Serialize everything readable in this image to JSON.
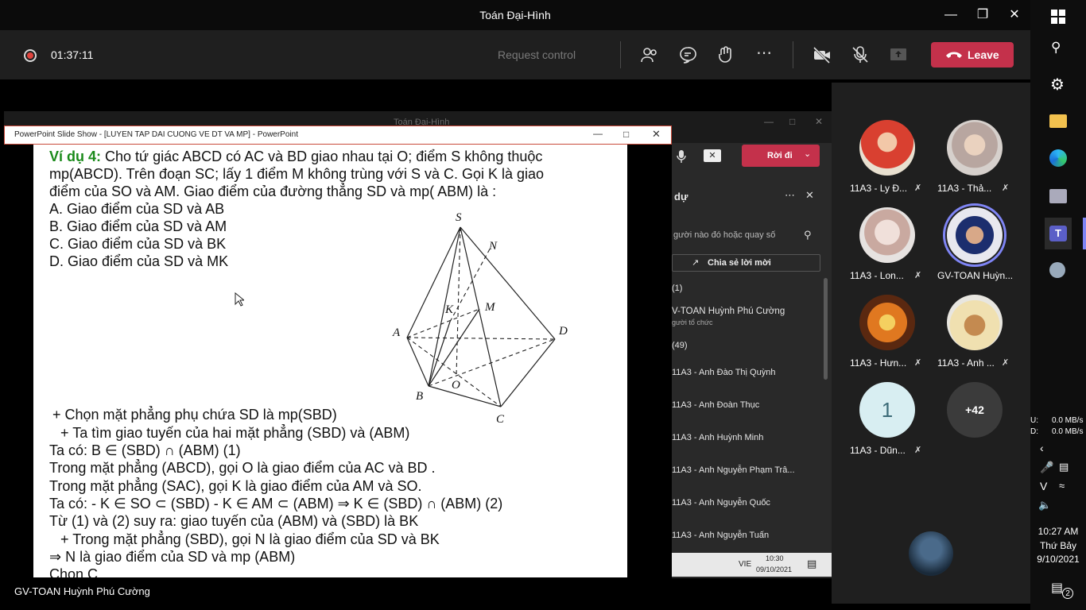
{
  "window": {
    "title": "Toán Đại-Hình"
  },
  "toolbar": {
    "timer": "01:37:11",
    "request_control": "Request control",
    "leave": "Leave"
  },
  "inner_window": {
    "title": "Toán Đại-Hình"
  },
  "ppt": {
    "title": "PowerPoint Slide Show - [LUYEN TAP DAI CUONG VE DT VA MP] - PowerPoint"
  },
  "slide": {
    "example_label": "Ví dụ 4:",
    "line1": " Cho tứ giác ABCD có AC và BD giao nhau tại O; điểm S không thuộc",
    "line2": "mp(ABCD). Trên đoạn SC; lấy 1 điểm M không trùng với S và C. Gọi K là giao",
    "line3": "điểm của SO và AM. Giao điểm của đường thẳng SD và mp( ABM) là :",
    "optA": "A. Giao điểm của SD và AB",
    "optB": "B. Giao điểm của SD và AM",
    "optC": "C. Giao điểm của SD và BK",
    "optD": "D. Giao điểm của SD và MK",
    "sol1": "+ Chọn mặt phẳng phụ chứa SD là mp(SBD)",
    "sol2": "+ Ta tìm giao tuyến của hai mặt phẳng (SBD) và (ABM)",
    "sol3": "Ta có: B ∈ (SBD) ∩ (ABM)    (1)",
    "sol4": "Trong mặt phẳng (ABCD), gọi O là giao điểm của AC và BD .",
    "sol5": "Trong mặt phẳng (SAC), gọi K là giao điểm của AM và SO.",
    "sol6": "Ta có: - K ∈ SO ⊂ (SBD)  - K ∈ AM ⊂ (ABM)  ⇒ K ∈ (SBD) ∩ (ABM)     (2)",
    "sol7": "Từ (1) và (2) suy ra: giao tuyến của (ABM) và (SBD) là BK",
    "sol8": "+ Trong mặt phẳng (SBD), gọi N là giao điểm của SD và BK",
    "sol9": "⇒ N là giao điểm của SD và mp (ABM)",
    "sol10": "Chọn C",
    "labels": {
      "S": "S",
      "N": "N",
      "K": "K",
      "M": "M",
      "A": "A",
      "D": "D",
      "O": "O",
      "B": "B",
      "C": "C"
    }
  },
  "panel": {
    "leave_btn": "Rời đi",
    "header": "dự",
    "search_placeholder": "gười nào đó hoặc quay số",
    "share_invite": "Chia sẻ lời mời",
    "section1": "(1)",
    "organizer_name": "V-TOAN Huỳnh Phú Cường",
    "organizer_role": "gười tổ chức",
    "section2": "(49)",
    "attendees": [
      "11A3 - Anh Đào Thị Quỳnh",
      "11A3 - Anh Đoàn Thục",
      "11A3 - Anh Huỳnh Minh",
      "11A3 - Anh Nguyễn Phạm Trâ...",
      "11A3 - Anh Nguyễn Quốc",
      "11A3 - Anh Nguyễn Tuấn"
    ],
    "taskbar_lang": "VIE",
    "taskbar_time": "10:30",
    "taskbar_date": "09/10/2021"
  },
  "gallery": {
    "tiles": [
      {
        "name": "11A3 - Ly Đ..."
      },
      {
        "name": "11A3 - Thả..."
      },
      {
        "name": "11A3 - Lon..."
      },
      {
        "name": "GV-TOAN Huỳn..."
      },
      {
        "name": "11A3 - Hưn..."
      },
      {
        "name": "11A3 - Anh ..."
      },
      {
        "name": "11A3 - Dũn...",
        "initial": "1"
      },
      {
        "name": "",
        "initial": "+42"
      }
    ]
  },
  "presenter_name": "GV-TOAN Huỳnh Phú Cường",
  "system": {
    "net_up": "0.0 MB/s",
    "net_down": "0.0 MB/s",
    "net_up_label": "U:",
    "net_down_label": "D:",
    "time": "10:27 AM",
    "day": "Thứ Bảy",
    "date": "9/10/2021",
    "notif_count": "2"
  },
  "colors": {
    "leave": "#c4314b",
    "teams_purple": "#5b5fc7",
    "slide_green": "#1a8a1a"
  }
}
